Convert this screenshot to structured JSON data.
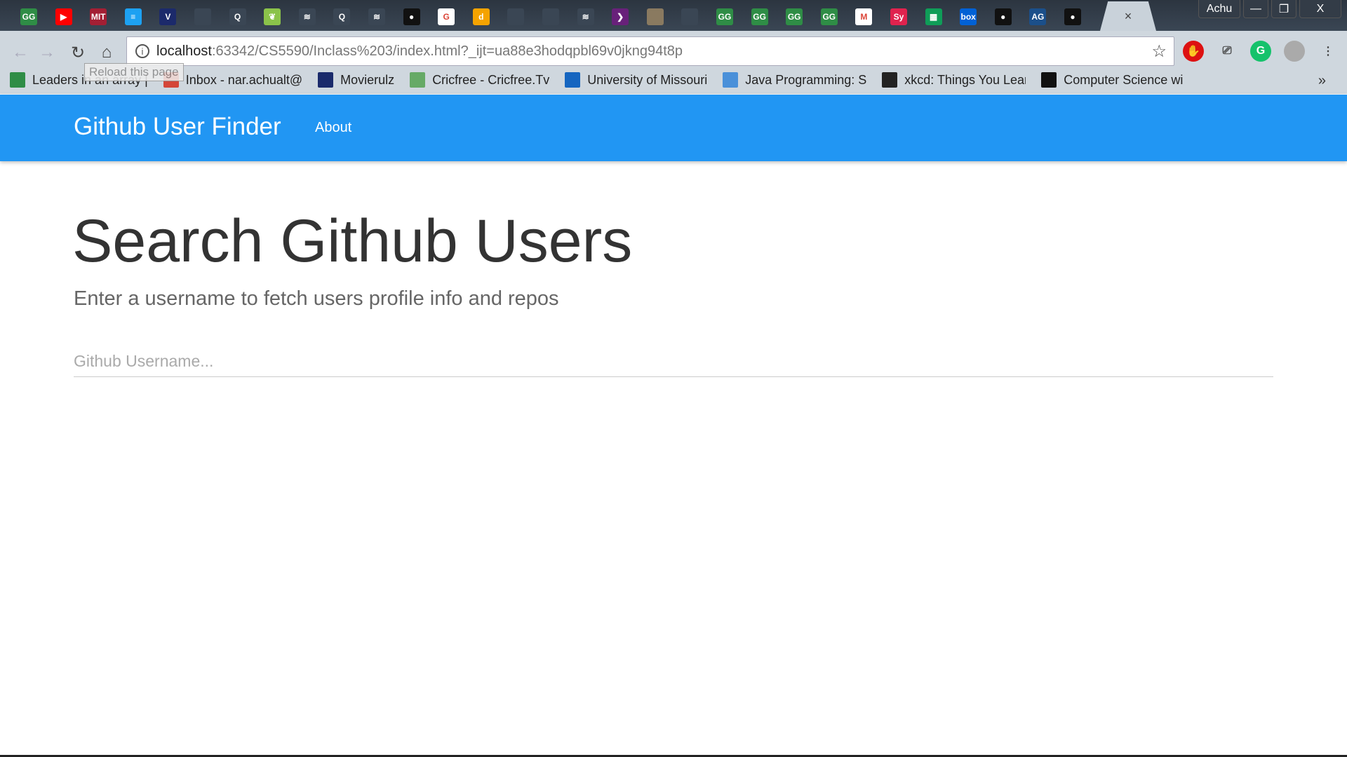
{
  "browser": {
    "tabs": [
      {
        "icon": "geeksforgeeks-icon",
        "color": "#2f8d46",
        "glyph": "GG"
      },
      {
        "icon": "youtube-icon",
        "color": "#ff0000",
        "glyph": "▶"
      },
      {
        "icon": "mit-ocw-icon",
        "color": "#a31f34",
        "glyph": "MIT"
      },
      {
        "icon": "lines-icon",
        "color": "#1da1f2",
        "glyph": "≡"
      },
      {
        "icon": "shield-icon",
        "color": "#1c2a6b",
        "glyph": "V"
      },
      {
        "icon": "blank-icon",
        "color": "#3a4654",
        "glyph": ""
      },
      {
        "icon": "quora-icon",
        "color": "#3a4654",
        "glyph": "Q"
      },
      {
        "icon": "leaf-icon",
        "color": "#8bc34a",
        "glyph": "❦"
      },
      {
        "icon": "stackoverflow-icon",
        "color": "#3a4654",
        "glyph": "≋"
      },
      {
        "icon": "quora-icon",
        "color": "#3a4654",
        "glyph": "Q"
      },
      {
        "icon": "stackoverflow-icon",
        "color": "#3a4654",
        "glyph": "≋"
      },
      {
        "icon": "github-icon",
        "color": "#111111",
        "glyph": "●"
      },
      {
        "icon": "google-icon",
        "color": "#ffffff",
        "glyph": "G"
      },
      {
        "icon": "dictionary-icon",
        "color": "#f5a300",
        "glyph": "d"
      },
      {
        "icon": "blank-icon",
        "color": "#3a4654",
        "glyph": ""
      },
      {
        "icon": "blank-icon",
        "color": "#3a4654",
        "glyph": ""
      },
      {
        "icon": "stackoverflow-icon",
        "color": "#3a4654",
        "glyph": "≋"
      },
      {
        "icon": "play-icon",
        "color": "#68217a",
        "glyph": "❯"
      },
      {
        "icon": "image-icon",
        "color": "#8a7a60",
        "glyph": ""
      },
      {
        "icon": "blank-icon",
        "color": "#3a4654",
        "glyph": ""
      },
      {
        "icon": "geeksforgeeks-icon",
        "color": "#2f8d46",
        "glyph": "GG"
      },
      {
        "icon": "geeksforgeeks-icon",
        "color": "#2f8d46",
        "glyph": "GG"
      },
      {
        "icon": "geeksforgeeks-icon",
        "color": "#2f8d46",
        "glyph": "GG"
      },
      {
        "icon": "geeksforgeeks-icon",
        "color": "#2f8d46",
        "glyph": "GG"
      },
      {
        "icon": "gmail-icon",
        "color": "#ffffff",
        "glyph": "M"
      },
      {
        "icon": "symbolab-icon",
        "color": "#e0234e",
        "glyph": "Sy"
      },
      {
        "icon": "sheets-icon",
        "color": "#0f9d58",
        "glyph": "▦"
      },
      {
        "icon": "box-icon",
        "color": "#0061d5",
        "glyph": "box"
      },
      {
        "icon": "github-icon",
        "color": "#111111",
        "glyph": "●"
      },
      {
        "icon": "adobe-icon",
        "color": "#1b4f8a",
        "glyph": "AG"
      },
      {
        "icon": "github-icon",
        "color": "#111111",
        "glyph": "●"
      }
    ],
    "active_tab_close": "×",
    "profile": "Achu",
    "minimize": "—",
    "restore": "❐",
    "close": "X",
    "url_host": "localhost",
    "url_rest": ":63342/CS5590/Inclass%203/index.html?_ijt=ua88e3hodqpbl69v0jkng94t8p",
    "tooltip": "Reload this page",
    "bookmarks": [
      {
        "label": "Leaders in an array |",
        "color": "#2f8d46"
      },
      {
        "label": "Inbox - nar.achualt@",
        "color": "#d44638"
      },
      {
        "label": "Movierulz",
        "color": "#1a2a6b"
      },
      {
        "label": "Cricfree - Cricfree.Tv",
        "color": "#6a6"
      },
      {
        "label": "University of Missouri",
        "color": "#1565c0"
      },
      {
        "label": "Java Programming: S",
        "color": "#4a90d9"
      },
      {
        "label": "xkcd: Things You Lear",
        "color": "#222222"
      },
      {
        "label": "Computer Science wi",
        "color": "#111111"
      }
    ],
    "more_bookmarks": "»"
  },
  "navbar": {
    "brand": "Github User Finder",
    "about": "About",
    "color": "#2196f3"
  },
  "main": {
    "title": "Search Github Users",
    "subtitle": "Enter a username to fetch users profile info and repos",
    "search_placeholder": "Github Username...",
    "search_value": ""
  }
}
